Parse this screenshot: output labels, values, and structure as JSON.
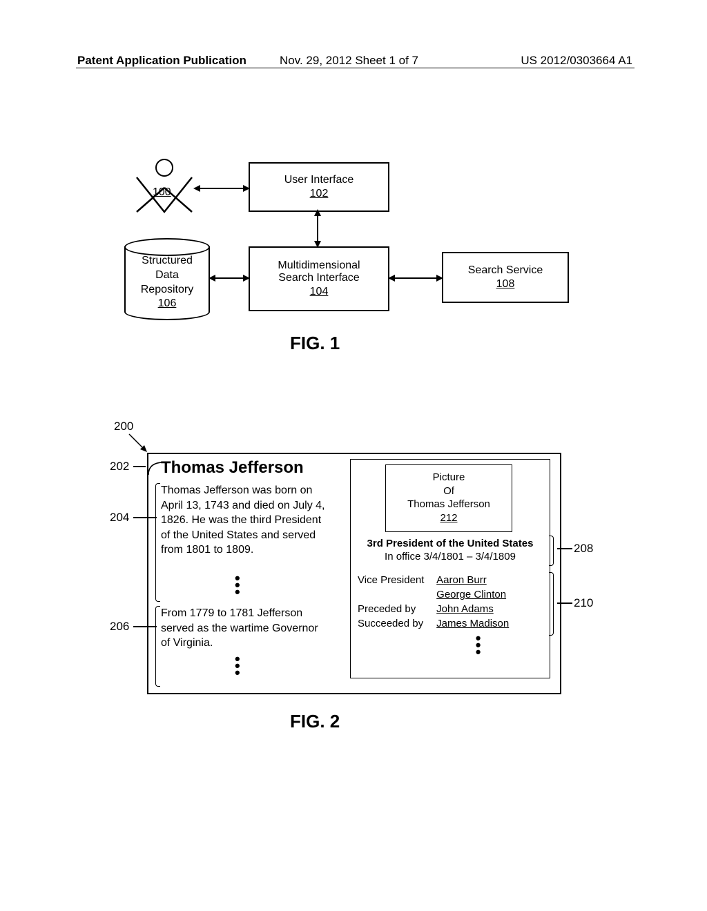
{
  "header": {
    "left": "Patent Application Publication",
    "center": "Nov. 29, 2012  Sheet 1 of 7",
    "right": "US 2012/0303664 A1"
  },
  "fig1": {
    "caption": "FIG. 1",
    "user_ref": "100",
    "ui": {
      "label": "User Interface",
      "ref": "102"
    },
    "msi": {
      "label": "Multidimensional\nSearch Interface",
      "ref": "104"
    },
    "repo": {
      "l1": "Structured",
      "l2": "Data",
      "l3": "Repository",
      "ref": "106"
    },
    "search": {
      "label": "Search Service",
      "ref": "108"
    }
  },
  "fig2": {
    "caption": "FIG. 2",
    "ref200": "200",
    "refs": {
      "r202": "202",
      "r204": "204",
      "r206": "206",
      "r208": "208",
      "r210": "210"
    },
    "title": "Thomas Jefferson",
    "para1": "Thomas Jefferson was born on April 13, 1743 and died on July 4, 1826.  He was the third President of the United States and served from 1801 to 1809.",
    "para2": "From 1779 to 1781 Jefferson served as the wartime Governor of Virginia.",
    "pic": {
      "l1": "Picture",
      "l2": "Of",
      "l3": "Thomas Jefferson",
      "ref": "212"
    },
    "cap208": {
      "t1": "3rd President of the United States",
      "t2": "In office 3/4/1801 – 3/4/1809"
    },
    "rows": [
      {
        "k": "Vice President",
        "v1": "Aaron Burr",
        "v2": "George Clinton"
      },
      {
        "k": "Preceded by",
        "v1": "John Adams"
      },
      {
        "k": "Succeeded by",
        "v1": "James Madison"
      }
    ]
  }
}
